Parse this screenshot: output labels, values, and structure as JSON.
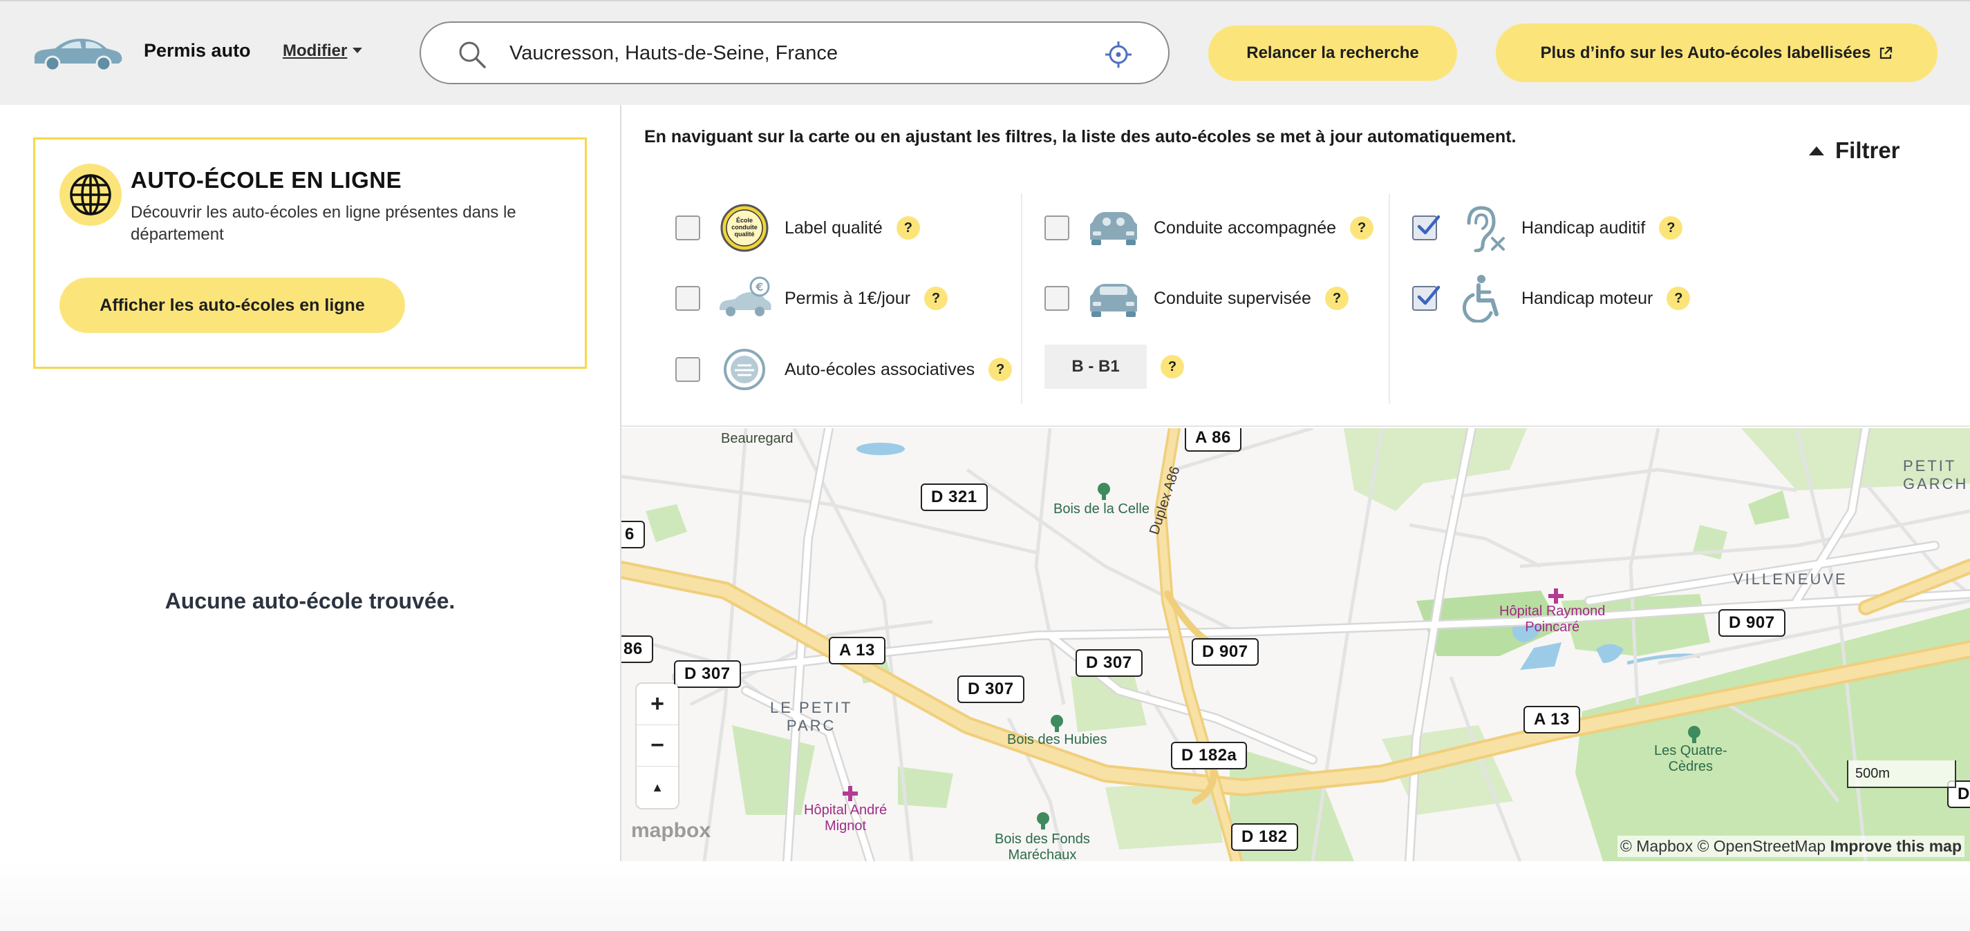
{
  "header": {
    "brand": "Permis auto",
    "modifier_label": "Modifier",
    "search_value": "Vaucresson, Hauts-de-Seine, France",
    "relancer_label": "Relancer la recherche",
    "info_label": "Plus d’info sur les Auto-écoles labellisées",
    "car_icon": "car-icon",
    "search_icon": "search-icon",
    "locate_icon": "crosshair-icon",
    "accent_color": "#fbe57b"
  },
  "online": {
    "title": "AUTO-ÉCOLE EN LIGNE",
    "description": "Découvrir les auto-écoles en ligne présentes dans le département",
    "button_label": "Afficher les auto-écoles en ligne",
    "icon": "globe-icon"
  },
  "results": {
    "empty_message": "Aucune auto-école trouvée."
  },
  "filters": {
    "notice": "En naviguant sur la carte ou en ajustant les filtres, la liste des auto-écoles se met à jour automatiquement.",
    "toggle_label": "Filtrer",
    "help_mark": "?",
    "items": [
      {
        "label": "Label qualité",
        "checked": false,
        "icon": "quality-label-icon"
      },
      {
        "label": "Permis à 1€/jour",
        "checked": false,
        "icon": "euro-car-icon"
      },
      {
        "label": "Auto-écoles associatives",
        "checked": false,
        "icon": "association-icon"
      },
      {
        "label": "Conduite accompagnée",
        "checked": false,
        "icon": "car-passengers-icon"
      },
      {
        "label": "Conduite supervisée",
        "checked": false,
        "icon": "car-icon"
      },
      {
        "label": "Handicap auditif",
        "checked": true,
        "icon": "hearing-impaired-icon"
      },
      {
        "label": "Handicap moteur",
        "checked": true,
        "icon": "wheelchair-icon"
      }
    ],
    "permis_value": "B - B1"
  },
  "map": {
    "roads": {
      "a86_top": "A 86",
      "d321": "D 321",
      "a86_left_partial": "6",
      "d86_left": "86",
      "d307_left": "D 307",
      "a13_left": "A 13",
      "d307_mid": "D 307",
      "d307_center": "D 307",
      "d907_center": "D 907",
      "d182a": "D 182a",
      "d182": "D 182",
      "a13_right": "A 13",
      "d907_right": "D 907",
      "d_edge": "D"
    },
    "places": {
      "beauregard": "Beauregard",
      "bois_celle": "Bois de la Celle",
      "duplex": "Duplex A86",
      "le_petit_parc": "LE PETIT\nPARC",
      "bois_hubies": "Bois des Hubies",
      "hopital_mignot": "Hôpital André\nMignot",
      "bois_fonds": "Bois des Fonds\nMaréchaux",
      "hopital_poincare": "Hôpital Raymond\nPoincaré",
      "villeneuve": "VILLENEUVE",
      "petit_garches": "PETIT\nGARCH",
      "quatre_cedres": "Les Quatre-\nCèdres"
    },
    "zoom_in": "+",
    "zoom_out": "−",
    "compass": "▲",
    "mapbox_logo": "mapbox",
    "attribution": "© Mapbox © OpenStreetMap",
    "improve_link": "Improve this map",
    "scale_label": "500m"
  }
}
